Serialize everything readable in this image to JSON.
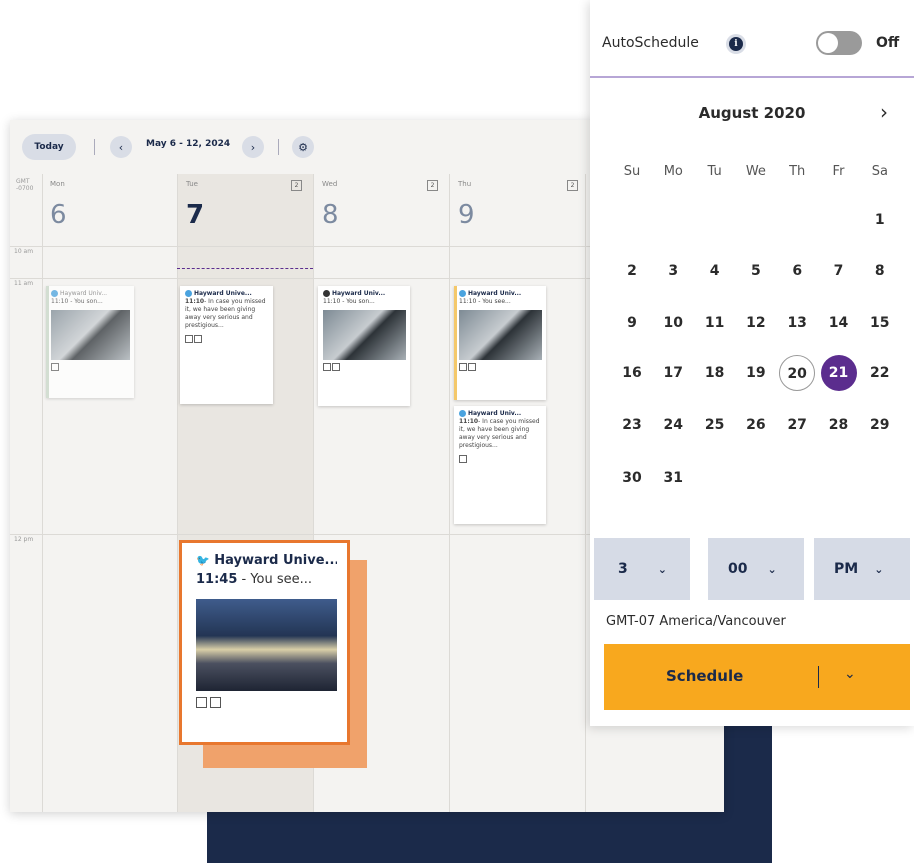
{
  "calendar": {
    "today_label": "Today",
    "range_label": "May 6 - 12, 2024",
    "timezone_short": "GMT -0700",
    "days": [
      {
        "name": "Mon",
        "num": "6",
        "count": ""
      },
      {
        "name": "Tue",
        "num": "7",
        "count": "2"
      },
      {
        "name": "Wed",
        "num": "8",
        "count": "2"
      },
      {
        "name": "Thu",
        "num": "9",
        "count": "2"
      }
    ],
    "time_labels": {
      "t10": "10 am",
      "t11": "11 am",
      "t12": "12 pm"
    },
    "posts": {
      "mon": {
        "author": "Hayward Univ...",
        "time": "11:10 - You son..."
      },
      "tue": {
        "author": "Hayward Unive...",
        "time": "11:10",
        "text": "- In case you missed it, we have been giving away very serious and prestigious..."
      },
      "wed": {
        "author": "Hayward Univ...",
        "time": "11:10 - You son..."
      },
      "thu1": {
        "author": "Hayward Univ...",
        "time": "11:10 - You see..."
      },
      "thu2": {
        "author": "Hayward Univ...",
        "time": "11:10",
        "text": "- In case you missed it, we have been giving away very serious and prestigious..."
      }
    },
    "dragged_post": {
      "author": "Hayward Unive...",
      "time": "11:45",
      "text": " - You see..."
    }
  },
  "panel": {
    "autoschedule_label": "AutoSchedule",
    "info_icon": "i",
    "toggle_label": "Off",
    "month_label": "August 2020",
    "weekdays": [
      "Su",
      "Mo",
      "Tu",
      "We",
      "Th",
      "Fr",
      "Sa"
    ],
    "weeks": [
      [
        "",
        "",
        "",
        "",
        "",
        "",
        "1"
      ],
      [
        "2",
        "3",
        "4",
        "5",
        "6",
        "7",
        "8"
      ],
      [
        "9",
        "10",
        "11",
        "12",
        "13",
        "14",
        "15"
      ],
      [
        "16",
        "17",
        "18",
        "19",
        "20",
        "21",
        "22"
      ],
      [
        "23",
        "24",
        "25",
        "26",
        "27",
        "28",
        "29"
      ],
      [
        "30",
        "31",
        "",
        "",
        "",
        "",
        ""
      ]
    ],
    "today_day": "20",
    "selected_day": "21",
    "hour": "3",
    "minute": "00",
    "ampm": "PM",
    "timezone": "GMT-07 America/Vancouver",
    "schedule_label": "Schedule",
    "accent": "#5b2d8e",
    "button_color": "#f8a81e"
  }
}
